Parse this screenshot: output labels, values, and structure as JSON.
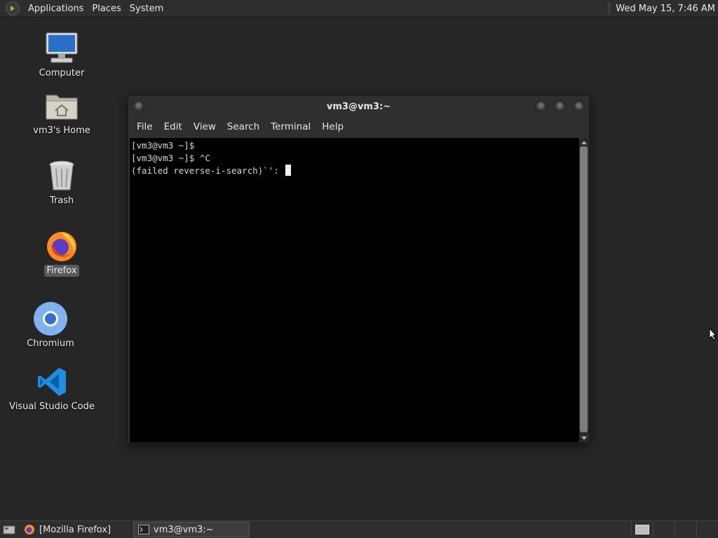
{
  "top_panel": {
    "menus": [
      "Applications",
      "Places",
      "System"
    ],
    "clock": "Wed May 15,  7:46 AM"
  },
  "desktop": {
    "icons": [
      {
        "label": "Computer",
        "icon": "computer-icon"
      },
      {
        "label": "vm3's Home",
        "icon": "home-folder-icon"
      },
      {
        "label": "Trash",
        "icon": "trash-icon"
      },
      {
        "label": "Firefox",
        "icon": "firefox-icon",
        "selected": true
      },
      {
        "label": "Chromium",
        "icon": "chromium-icon"
      },
      {
        "label": "Visual Studio Code",
        "icon": "vscode-icon"
      }
    ]
  },
  "terminal": {
    "title": "vm3@vm3:~",
    "menu": [
      "File",
      "Edit",
      "View",
      "Search",
      "Terminal",
      "Help"
    ],
    "lines": [
      "[vm3@vm3 ~]$",
      "[vm3@vm3 ~]$ ^C",
      "(failed reverse-i-search)`': "
    ]
  },
  "taskbar": {
    "tasks": [
      {
        "label": "[Mozilla Firefox]",
        "icon": "firefox-icon",
        "active": false
      },
      {
        "label": "vm3@vm3:~",
        "icon": "terminal-icon",
        "active": true
      }
    ]
  },
  "colors": {
    "desktop_bg": "#262626",
    "panel_bg": "#2e2e2e",
    "terminal_bg": "#000000",
    "vscode_blue": "#0a84d6",
    "chromium_blue": "#4a8ee8"
  }
}
